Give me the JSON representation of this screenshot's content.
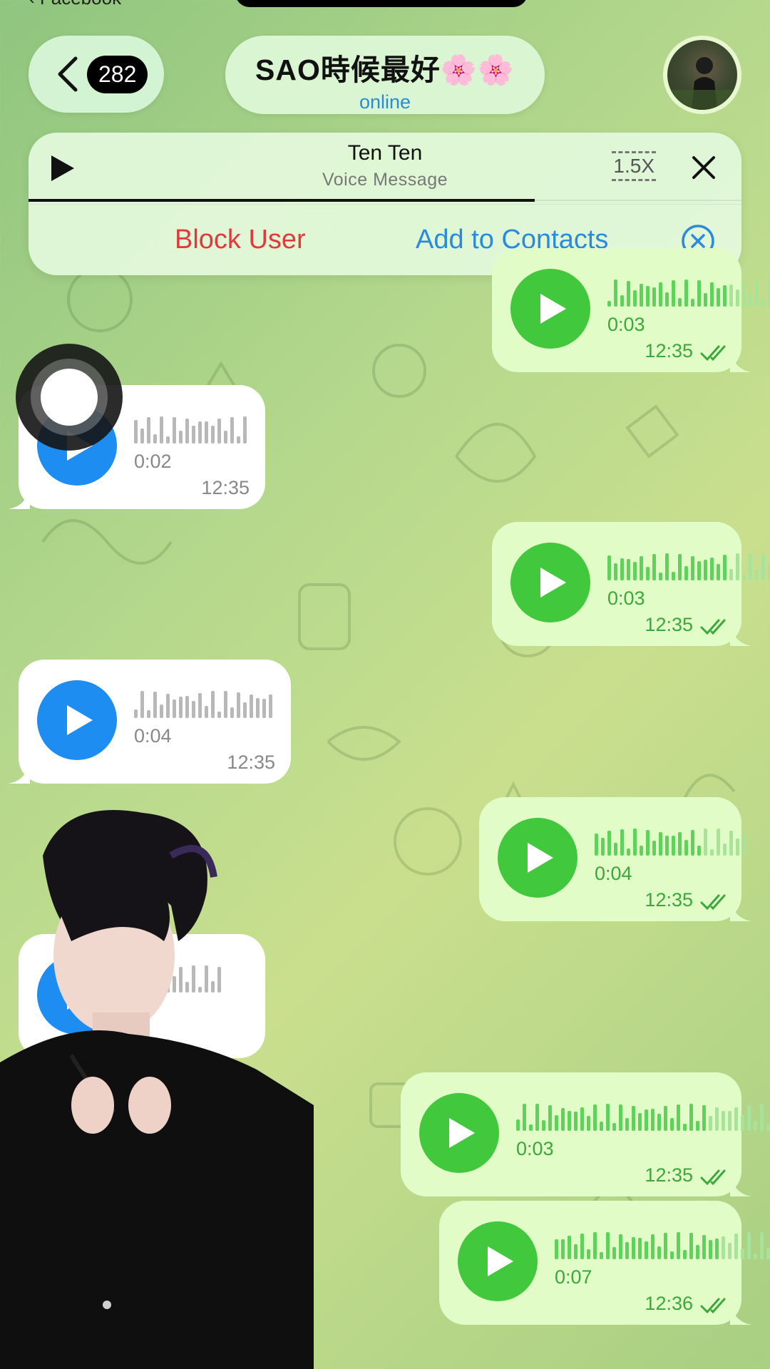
{
  "status": {
    "source_app": "‹ Facebook"
  },
  "header": {
    "back_badge": "282",
    "title": "SAO時候最好🌸🌸",
    "status": "online"
  },
  "player": {
    "name": "Ten Ten",
    "subtitle": "Voice Message",
    "speed": "1.5X",
    "progress": 0.71
  },
  "actions": {
    "block": "Block User",
    "add_contacts": "Add to Contacts"
  },
  "messages": [
    {
      "direction": "out",
      "duration": "0:03",
      "time": "12:35",
      "read": true
    },
    {
      "direction": "in",
      "duration": "0:02",
      "time": "12:35"
    },
    {
      "direction": "out",
      "duration": "0:03",
      "time": "12:35",
      "read": true
    },
    {
      "direction": "in",
      "duration": "0:04",
      "time": "12:35"
    },
    {
      "direction": "out",
      "duration": "0:04",
      "time": "12:35",
      "read": true
    },
    {
      "direction": "in",
      "duration": "",
      "time": ""
    },
    {
      "direction": "out",
      "duration": "0:03",
      "time": "12:35",
      "read": true
    },
    {
      "direction": "out",
      "duration": "0:07",
      "time": "12:36",
      "read": true
    }
  ],
  "colors": {
    "outgoing_bubble": "#e2fcc7",
    "incoming_bubble": "#ffffff",
    "outgoing_play": "#42c83c",
    "incoming_play": "#1e8df2",
    "link_blue": "#2a8bdc",
    "block_red": "#e03a3a"
  },
  "icons": {
    "back": "chevron-left-icon",
    "player_play": "play-icon",
    "player_close": "close-icon",
    "dismiss": "circle-x-icon",
    "read": "double-check-icon"
  }
}
